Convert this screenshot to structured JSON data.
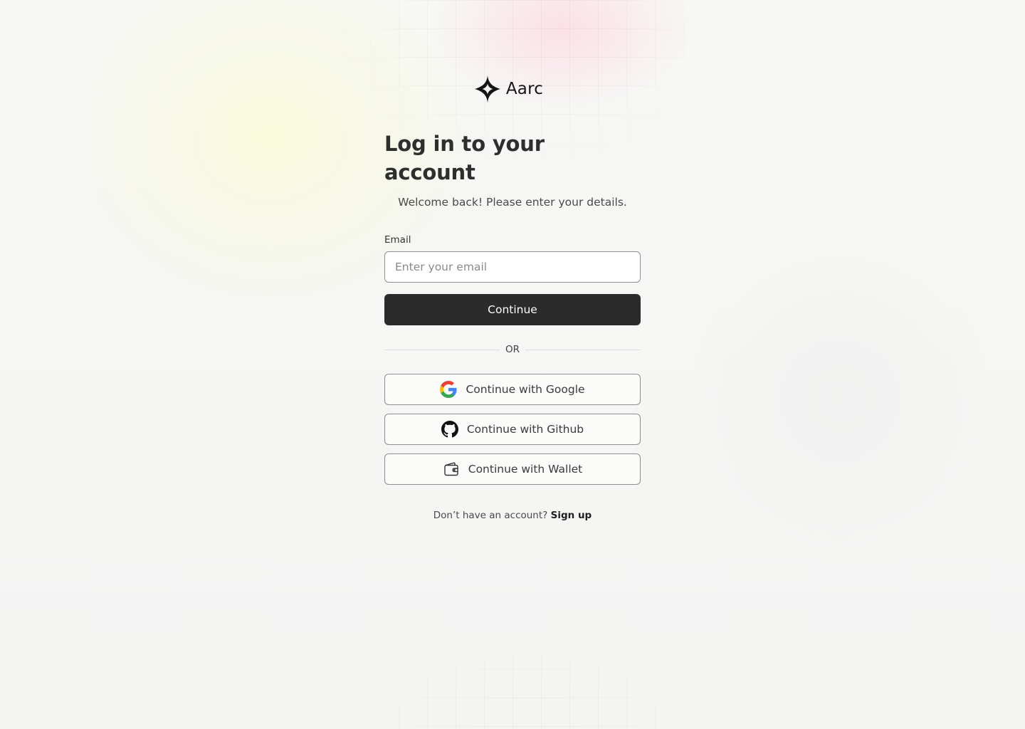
{
  "brand": {
    "name": "Aarc",
    "logo_icon": "sparkle-star-icon"
  },
  "header": {
    "title": "Log in to your account",
    "subtitle": "Welcome back! Please enter your details."
  },
  "form": {
    "email_label": "Email",
    "email_placeholder": "Enter your email",
    "email_value": "",
    "continue_label": "Continue"
  },
  "divider": {
    "label": "OR"
  },
  "social": {
    "google_label": "Continue with Google",
    "google_icon": "google-icon",
    "github_label": "Continue with Github",
    "github_icon": "github-icon",
    "wallet_label": "Continue with Wallet",
    "wallet_icon": "wallet-icon"
  },
  "footer": {
    "prompt": "Don’t have an account?",
    "signup_label": "Sign up"
  },
  "colors": {
    "primary_button": "#2b2b2b",
    "background": "#f5f5f4",
    "border": "#8f8f8f"
  }
}
